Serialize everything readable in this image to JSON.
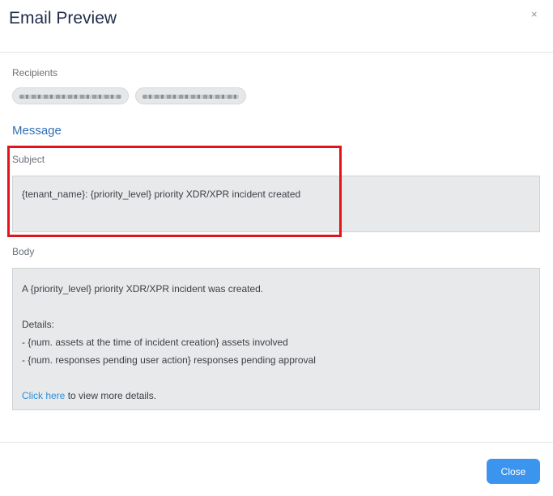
{
  "dialog": {
    "title": "Email Preview",
    "close_icon": "×"
  },
  "recipients": {
    "label": "Recipients",
    "chips": [
      {
        "value": "redacted-recipient-1"
      },
      {
        "value": "redacted-recipient-2"
      }
    ]
  },
  "message": {
    "title": "Message",
    "subject_label": "Subject",
    "subject_value": "{tenant_name}: {priority_level} priority XDR/XPR incident created",
    "body_label": "Body",
    "body": {
      "line1": "A {priority_level} priority XDR/XPR incident was created.",
      "details_heading": "Details:",
      "detail1": "- {num. assets at the time of incident creation} assets involved",
      "detail2": "- {num. responses pending user action} responses pending approval",
      "link_text": "Click here",
      "link_suffix": " to view more details."
    }
  },
  "footer": {
    "close_label": "Close"
  },
  "colors": {
    "highlight": "#e2141a",
    "accent": "#3b95ee",
    "link": "#2f8fd8"
  }
}
